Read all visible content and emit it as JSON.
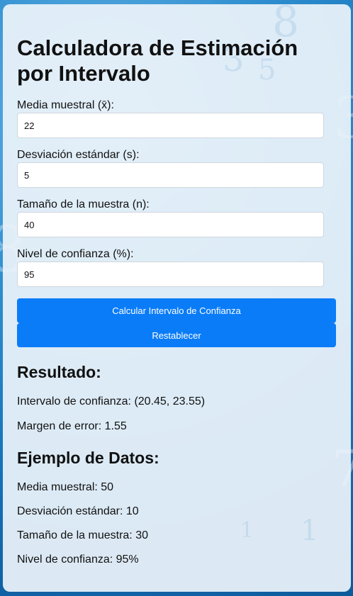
{
  "title": "Calculadora de Estimación por Intervalo",
  "form": {
    "mean": {
      "label": "Media muestral (x̄):",
      "value": "22"
    },
    "std": {
      "label": "Desviación estándar (s):",
      "value": "5"
    },
    "size": {
      "label": "Tamaño de la muestra (n):",
      "value": "40"
    },
    "confidence": {
      "label": "Nivel de confianza (%):",
      "value": "95"
    }
  },
  "buttons": {
    "calculate": "Calcular Intervalo de Confianza",
    "reset": "Restablecer"
  },
  "result": {
    "heading": "Resultado:",
    "interval": "Intervalo de confianza: (20.45, 23.55)",
    "margin": "Margen de error: 1.55"
  },
  "example": {
    "heading": "Ejemplo de Datos:",
    "mean": "Media muestral: 50",
    "std": "Desviación estándar: 10",
    "size": "Tamaño de la muestra: 30",
    "confidence": "Nivel de confianza: 95%"
  },
  "colors": {
    "accent": "#0a7cf8",
    "card_background": "#ecf3fa",
    "page_background": "#1e80c6"
  }
}
